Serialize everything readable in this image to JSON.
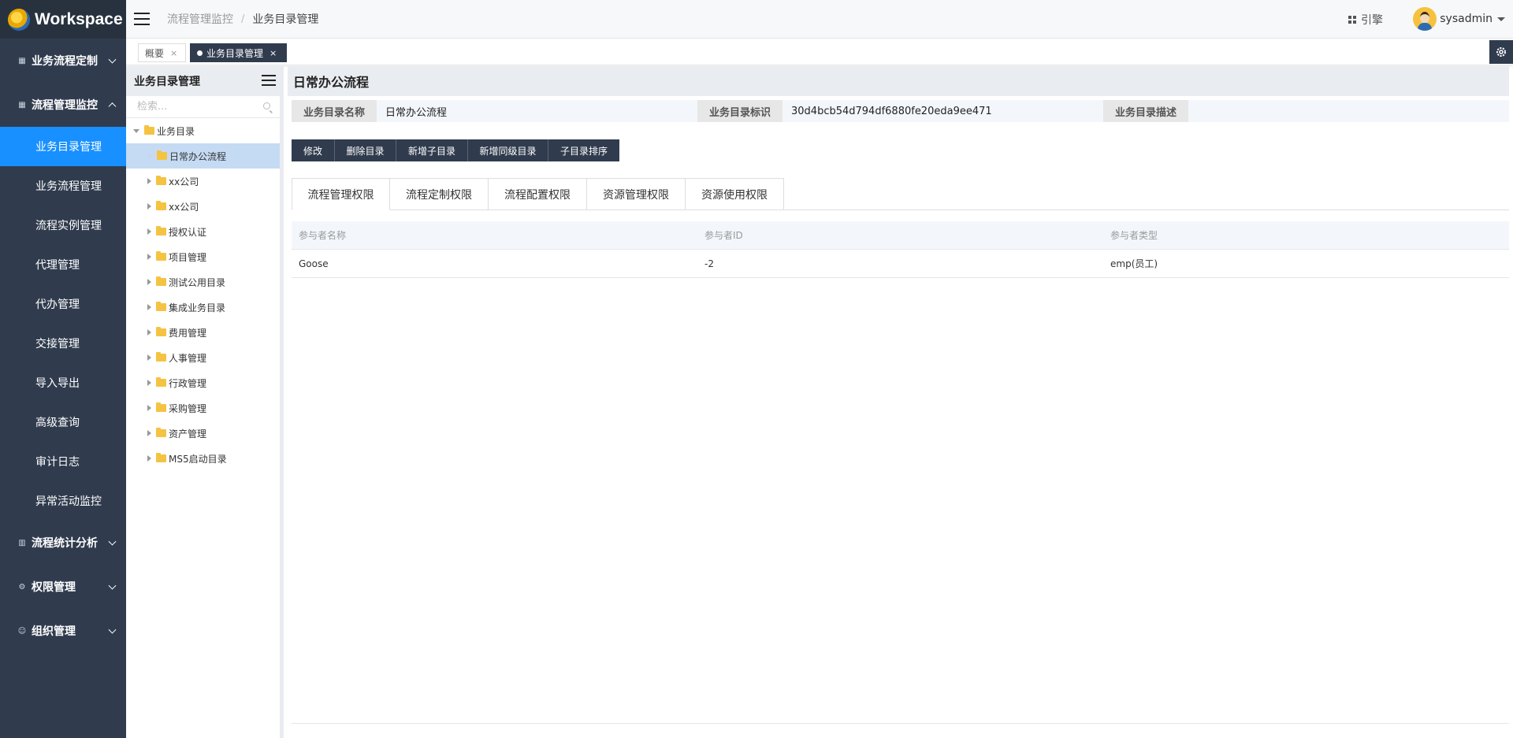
{
  "brand": {
    "name": "Workspace"
  },
  "sidebar": {
    "groups": [
      {
        "label": "业务流程定制",
        "icon": "grid-icon",
        "expanded": false
      },
      {
        "label": "流程管理监控",
        "icon": "grid-icon",
        "expanded": true,
        "items": [
          "业务目录管理",
          "业务流程管理",
          "流程实例管理",
          "代理管理",
          "代办管理",
          "交接管理",
          "导入导出",
          "高级查询",
          "审计日志",
          "异常活动监控"
        ]
      },
      {
        "label": "流程统计分析",
        "icon": "chart-icon",
        "expanded": false
      },
      {
        "label": "权限管理",
        "icon": "gear-icon",
        "expanded": false
      },
      {
        "label": "组织管理",
        "icon": "user-icon",
        "expanded": false
      }
    ],
    "active_item": "业务目录管理"
  },
  "topbar": {
    "breadcrumb": [
      "流程管理监控",
      "业务目录管理"
    ],
    "breadcrumb_sep": "/",
    "engine_label": "引擎",
    "user_name": "sysadmin"
  },
  "tabs": [
    {
      "label": "概要",
      "close": "×"
    },
    {
      "label": "业务目录管理",
      "close": "×",
      "active": true
    }
  ],
  "tree": {
    "title": "业务目录管理",
    "search_placeholder": "检索...",
    "root": "业务目录",
    "children": [
      "日常办公流程",
      "xx公司",
      "xx公司",
      "授权认证",
      "项目管理",
      "测试公用目录",
      "集成业务目录",
      "费用管理",
      "人事管理",
      "行政管理",
      "采购管理",
      "资产管理",
      "MS5启动目录"
    ],
    "selected": "日常办公流程"
  },
  "main": {
    "title": "日常办公流程",
    "info": {
      "name_label": "业务目录名称",
      "name_value": "日常办公流程",
      "id_label": "业务目录标识",
      "id_value": "30d4bcb54d794df6880fe20eda9ee471",
      "desc_label": "业务目录描述",
      "desc_value": ""
    },
    "actions": [
      "修改",
      "删除目录",
      "新增子目录",
      "新增同级目录",
      "子目录排序"
    ],
    "perm_tabs": [
      "流程管理权限",
      "流程定制权限",
      "流程配置权限",
      "资源管理权限",
      "资源使用权限"
    ],
    "grid": {
      "columns": [
        "参与者名称",
        "参与者ID",
        "参与者类型"
      ],
      "rows": [
        [
          "Goose",
          "-2",
          "emp(员工)"
        ]
      ]
    }
  },
  "colors": {
    "sidebar_bg": "#303c4e",
    "active_blue": "#1890ff",
    "selected_tree": "#c5dbf3",
    "folder": "#f5c342"
  }
}
